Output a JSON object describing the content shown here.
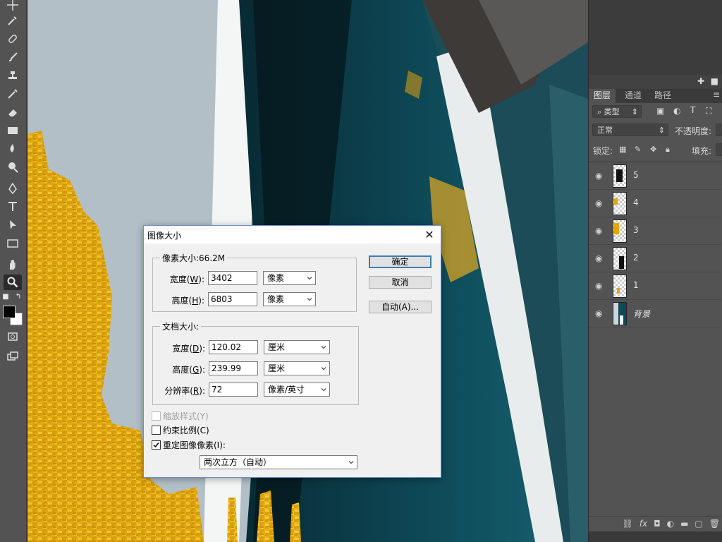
{
  "colors": {
    "ui_dark": "#535353",
    "dialog_bg": "#f0f0f0",
    "accent_border": "#3c7fb1"
  },
  "toolbar": {
    "tools": [
      "move-icon",
      "eyedropper-icon",
      "healing-brush-icon",
      "brush-icon",
      "clone-stamp-icon",
      "history-brush-icon",
      "eraser-icon",
      "gradient-icon",
      "blur-icon",
      "dodge-icon",
      "pen-icon",
      "type-icon",
      "path-selection-icon",
      "rectangle-icon",
      "hand-icon",
      "zoom-icon"
    ],
    "active_tool": "zoom-icon"
  },
  "panel": {
    "tabs": [
      "图层",
      "通道",
      "路径"
    ],
    "active_tab": "图层",
    "filter_kind": "类型",
    "blend_mode": "正常",
    "opacity_label": "不透明度:",
    "lock_label": "锁定:",
    "fill_label": "填充:",
    "layers": [
      {
        "name": "5"
      },
      {
        "name": "4"
      },
      {
        "name": "3"
      },
      {
        "name": "2"
      },
      {
        "name": "1"
      },
      {
        "name": "背景"
      }
    ],
    "bottom_icons": [
      "link-icon",
      "fx-icon",
      "mask-icon",
      "adjustment-icon",
      "folder-icon",
      "new-layer-icon",
      "trash-icon"
    ]
  },
  "dialog": {
    "title": "图像大小",
    "pixel_group": {
      "legend": "像素大小:66.2M",
      "width_label": "宽度(",
      "width_key": "W",
      "width_value": "3402",
      "width_unit": "像素",
      "height_label": "高度(",
      "height_key": "H",
      "height_value": "6803",
      "height_unit": "像素"
    },
    "doc_group": {
      "legend": "文档大小:",
      "width_label": "宽度(",
      "width_key": "D",
      "width_value": "120.02",
      "width_unit": "厘米",
      "height_label": "高度(",
      "height_key": "G",
      "height_value": "239.99",
      "height_unit": "厘米",
      "res_label": "分辨率(",
      "res_key": "R",
      "res_value": "72",
      "res_unit": "像素/英寸"
    },
    "ok": "确定",
    "cancel": "取消",
    "auto": "自动(A)...",
    "scale_styles": "缩放样式(Y)",
    "constrain": "约束比例(C)",
    "resample": "重定图像像素(I):",
    "resample_method": "两次立方（自动）",
    "checks": {
      "scale_styles": false,
      "constrain": false,
      "resample": true
    }
  }
}
